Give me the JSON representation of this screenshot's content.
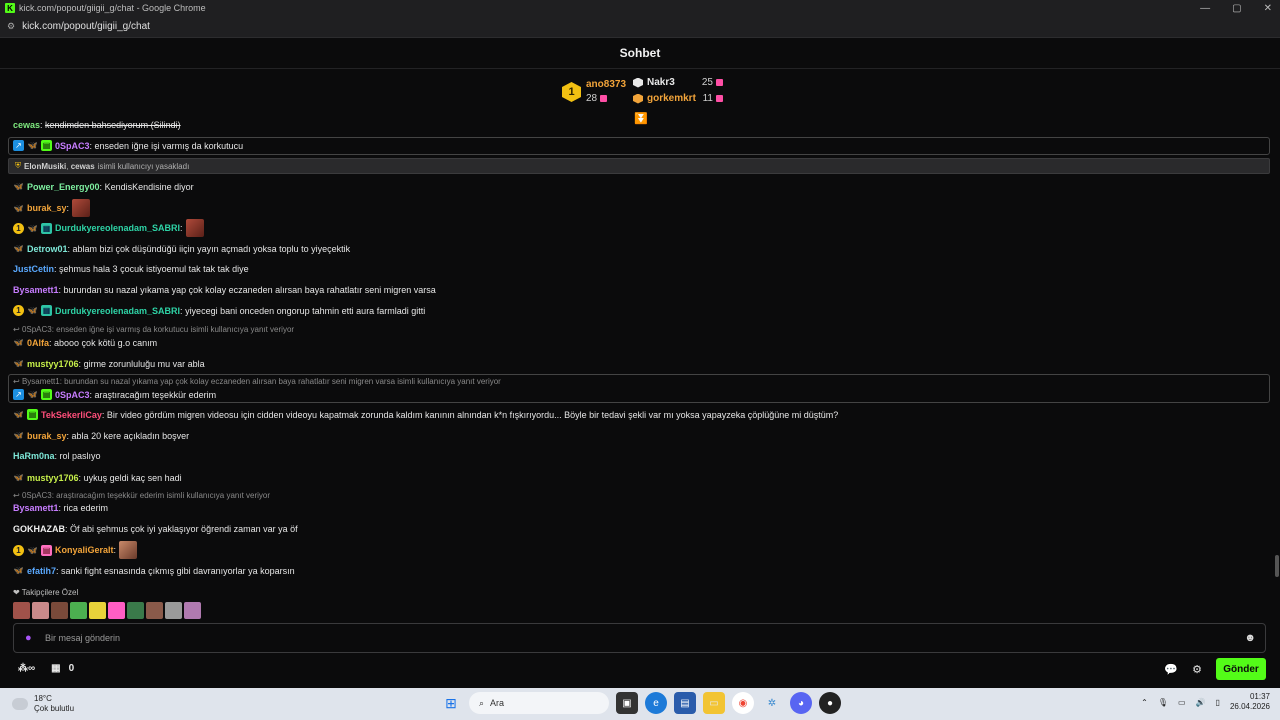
{
  "browser": {
    "window_title": "kick.com/popout/giigii_g/chat - Google Chrome",
    "url": "kick.com/popout/giigii_g/chat",
    "favicon_letter": "K"
  },
  "chat": {
    "title": "Sohbet",
    "leaderboard": {
      "first": {
        "rank": "1",
        "user": "ano8373",
        "count": "28"
      },
      "second": {
        "user": "Nakr3",
        "count": "25",
        "color": "#e8e8e8"
      },
      "third": {
        "user": "gorkemkrt",
        "count": "11",
        "color": "#f2a43a"
      }
    },
    "messages": {
      "m0": {
        "user": "cewas",
        "text": "kendimden bahsediyorum (Silindi)"
      },
      "m1": {
        "user": "0SpAC3",
        "text": "enseden iğne işi varmış da korkutucu"
      },
      "mod": {
        "actor": "ElonMusiki",
        "target": "cewas",
        "suffix": "isimli kullanıcıyı yasakladı"
      },
      "m2": {
        "user": "Power_Energy00",
        "text": "KendisKendisine diyor"
      },
      "m3": {
        "user": "burak_sy",
        "text": ""
      },
      "m4": {
        "user": "Durdukyereolenadam_SABRI",
        "text": ""
      },
      "m5": {
        "user": "Detrow01",
        "text": "ablam bizi çok düşündüğü iiçin yayın açmadı yoksa toplu to yiyeçektik"
      },
      "m6": {
        "user": "JustCetin",
        "text": "şehmus hala 3 çocuk istiyoemul tak tak tak diye"
      },
      "m7": {
        "user": "Bysamett1",
        "text": "burundan su nazal yıkama yap çok kolay eczaneden alırsan baya rahatlatır seni migren varsa"
      },
      "m8": {
        "user": "Durdukyereolenadam_SABRI",
        "text": "yiyecegi bani onceden ongorup tahmin etti aura farmladi gitti"
      },
      "r1": "0SpAC3: enseden iğne işi varmış da korkutucu isimli kullanıcıya yanıt veriyor",
      "m9": {
        "user": "0Alfa",
        "text": "abooo çok kötü g.o canım"
      },
      "m10": {
        "user": "mustyy1706",
        "text": "girme zorunluluğu mu var abla"
      },
      "r2": "Bysamett1: burundan su nazal yıkama yap çok kolay eczaneden alırsan baya rahatlatır seni migren varsa isimli kullanıcıya yanıt veriyor",
      "m11": {
        "user": "0SpAC3",
        "text": "araştıracağım teşekkür ederim"
      },
      "m12": {
        "user": "TekSekerliCay",
        "text": "Bir video gördüm migren videosu için cidden videoyu kapatmak zorunda kaldım kanının alnından k*n fışkırıyordu... Böyle bir tedavi şekli var mı yoksa yapayzeka çöplüğüne mi düştüm?"
      },
      "m13": {
        "user": "burak_sy",
        "text": "abla 20 kere açıkladın boşver"
      },
      "m14": {
        "user": "HaRm0na",
        "text": "rol paslıyo"
      },
      "m15": {
        "user": "mustyy1706",
        "text": "uykuş geldi kaç sen hadi"
      },
      "r3": "0SpAC3: araştıracağım teşekkür ederim isimli kullanıcıya yanıt veriyor",
      "m16": {
        "user": "Bysamett1",
        "text": "rica ederim"
      },
      "m17": {
        "user": "GOKHAZAB",
        "text": "Öf abi şehmus çok iyi yaklaşıyor öğrendi zaman var ya öf"
      },
      "m18": {
        "user": "KonyaliGeralt",
        "text": ""
      },
      "m19": {
        "user": "efatih7",
        "text": "sanki fight esnasında çıkmış gibi davranıyorlar ya koparsın"
      }
    },
    "followers_only_label": "Takipçilere Özel",
    "input_placeholder": "Bir mesaj gönderin",
    "infinite_symbol": "∞",
    "shop_count": "0",
    "send_label": "Gönder"
  },
  "taskbar": {
    "temperature": "18°C",
    "weather": "Çok bulutlu",
    "search_label": "Ara",
    "time": "01:37",
    "date": "26.04.2026"
  },
  "colors": {
    "accent": "#53fc18",
    "background": "#0b0b0c"
  }
}
